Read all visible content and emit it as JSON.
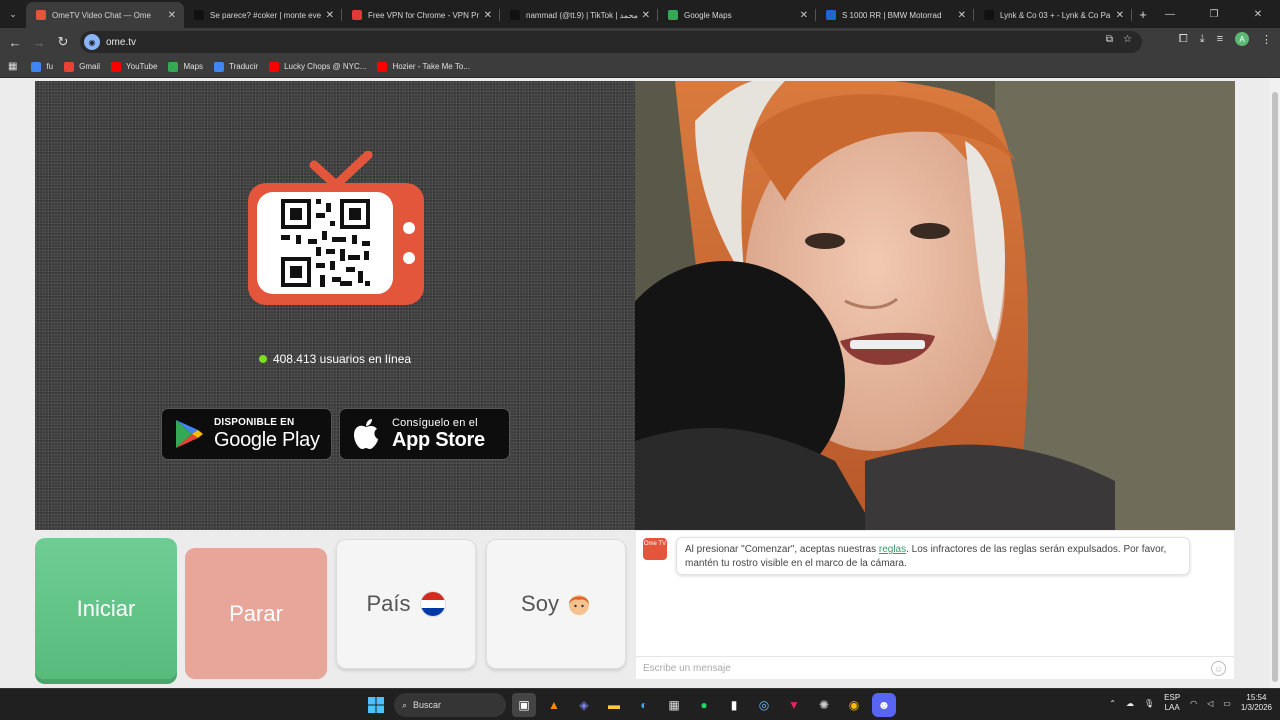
{
  "tabs": [
    {
      "title": "OmeTV Video Chat — Ome",
      "favicon": "ometv-icon",
      "color": "#e4563c",
      "active": true
    },
    {
      "title": "Se parece? #coker | monte eve",
      "favicon": "tiktok-icon",
      "color": "#111111"
    },
    {
      "title": "Free VPN for Chrome - VPN Pr",
      "favicon": "vpn-icon",
      "color": "#e53935"
    },
    {
      "title": "nammad (@tt.9) | TikTok | محمد",
      "favicon": "tiktok-icon",
      "color": "#111111"
    },
    {
      "title": "Google Maps",
      "favicon": "maps-icon",
      "color": "#34a853"
    },
    {
      "title": "S 1000 RR | BMW Motorrad",
      "favicon": "bmw-icon",
      "color": "#1c69d4"
    },
    {
      "title": "Lynk & Co 03 + - Lynk & Co Pa",
      "favicon": "lynk-icon",
      "color": "#111111"
    }
  ],
  "address": {
    "url": "ome.tv"
  },
  "bookmarks": [
    {
      "label": "fu",
      "icon": "google-icon",
      "color": "#4285f4"
    },
    {
      "label": "Gmail",
      "icon": "gmail-icon",
      "color": "#ea4335"
    },
    {
      "label": "YouTube",
      "icon": "youtube-icon",
      "color": "#ff0000"
    },
    {
      "label": "Maps",
      "icon": "maps-icon",
      "color": "#34a853"
    },
    {
      "label": "Traducir",
      "icon": "translate-icon",
      "color": "#4285f4"
    },
    {
      "label": "Lucky Chops @ NYC...",
      "icon": "youtube-icon",
      "color": "#ff0000"
    },
    {
      "label": "Hozier - Take Me To...",
      "icon": "youtube-icon",
      "color": "#ff0000"
    }
  ],
  "video": {
    "online_text": "408.413 usuarios en línea",
    "google_play": {
      "small": "DISPONIBLE EN",
      "big": "Google Play"
    },
    "app_store": {
      "small": "Consíguelo en el",
      "big": "App Store"
    }
  },
  "controls": {
    "start": "Iniciar",
    "stop": "Parar",
    "country": "País",
    "iam": "Soy"
  },
  "chat": {
    "logo": "Ome TV",
    "message_before": "Al presionar \"Comenzar\", aceptas nuestras ",
    "rules_link": "reglas",
    "message_after": ". Los infractores de las reglas serán expulsados. Por favor, mantén tu rostro visible en el marco de la cámara.",
    "input_placeholder": "Escribe un mensaje"
  },
  "taskbar": {
    "search_label": "Buscar",
    "language": "ESP",
    "layout": "LAA",
    "time": "15:54",
    "date": "1/3/2026"
  },
  "colors": {
    "start": "#5cc184",
    "stop": "#e8a69a",
    "brand": "#e4563c",
    "online_dot": "#7ddd22"
  }
}
